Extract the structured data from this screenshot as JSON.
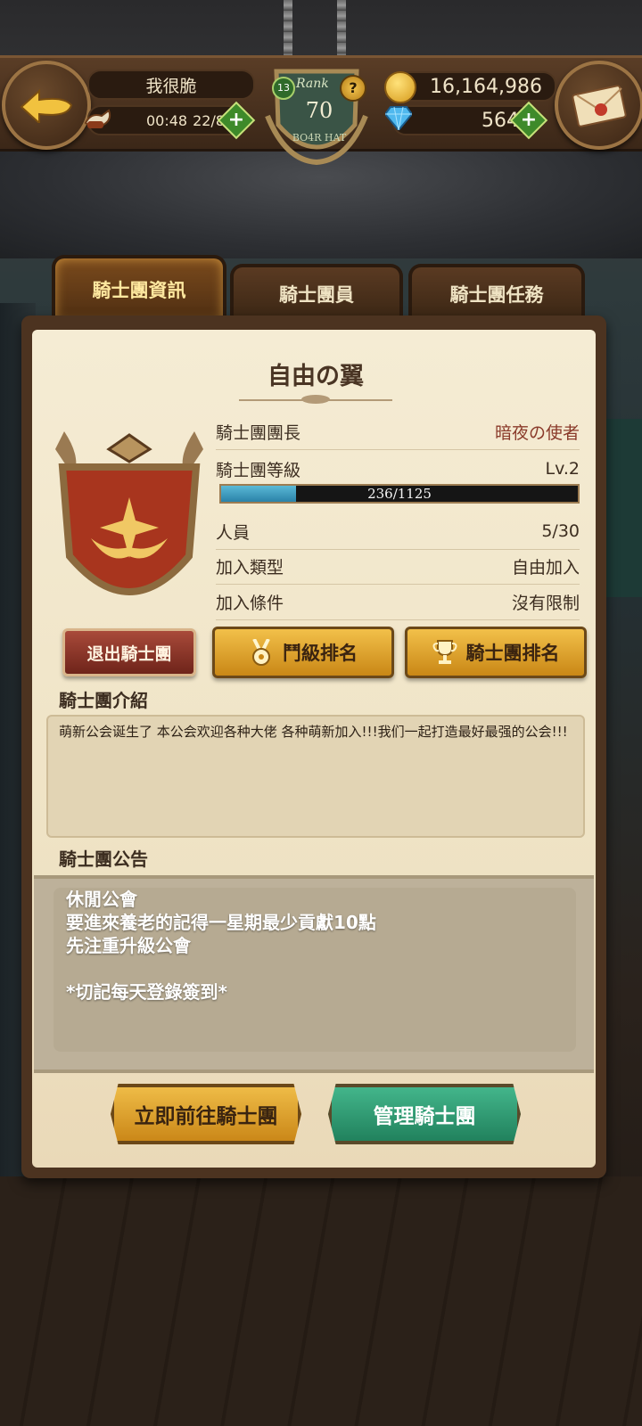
{
  "header": {
    "player_name": "我很脆",
    "stamina_timer": "00:48",
    "stamina_value": "22/89",
    "gold": "16,164,986",
    "gems": "564",
    "rank_label": "Rank",
    "rank_value": "70",
    "rank_level": "13",
    "rank_sub": "BO4R HAT",
    "help_symbol": "?",
    "plus_symbol": "+"
  },
  "tabs": [
    {
      "label": "騎士團資訊",
      "active": true
    },
    {
      "label": "騎士團員",
      "active": false
    },
    {
      "label": "騎士團任務",
      "active": false
    }
  ],
  "guild": {
    "name": "自由の翼",
    "leader_label": "騎士團團長",
    "leader_value": "暗夜の使者",
    "level_label": "騎士團等級",
    "level_value": "Lv.2",
    "exp_text": "236/1125",
    "exp_progress": 0.21,
    "members_label": "人員",
    "members_value": "5/30",
    "join_type_label": "加入類型",
    "join_type_value": "自由加入",
    "join_cond_label": "加入條件",
    "join_cond_value": "沒有限制"
  },
  "buttons": {
    "quit": "退出騎士團",
    "duel_rank": "鬥級排名",
    "guild_rank": "騎士團排名",
    "goto": "立即前往騎士團",
    "manage": "管理騎士團"
  },
  "intro": {
    "title": "騎士團介紹",
    "text": "萌新公会诞生了 本公会欢迎各种大佬 各种萌新加入!!!我们一起打造最好最强的公会!!!"
  },
  "notice": {
    "title": "騎士團公告",
    "lines": [
      "休閒公會",
      "要進來養老的記得一星期最少貢獻10點",
      "先注重升級公會",
      "",
      "*切記每天登錄簽到*"
    ]
  },
  "colors": {
    "accent_gold": "#c98716",
    "accent_green": "#1f7e5a",
    "danger_red": "#8a3a2a",
    "exp_blue": "#2a82a8"
  },
  "icons": {
    "back": "back-arrow-icon",
    "mail": "mail-icon",
    "coin": "gold-coin-icon",
    "gem": "diamond-icon",
    "stamina": "wing-boot-icon",
    "medal": "medal-icon",
    "trophy": "trophy-icon",
    "crest": "guild-crest-icon"
  }
}
